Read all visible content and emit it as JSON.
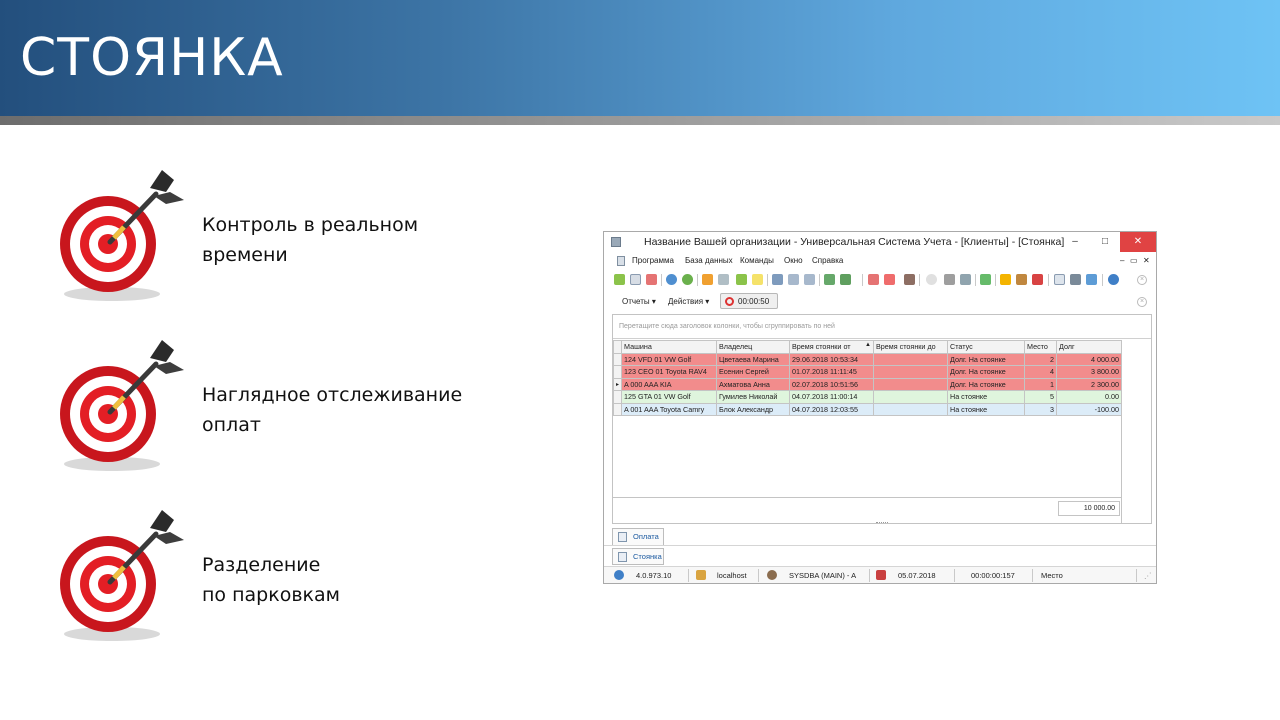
{
  "slide": {
    "title": "СТОЯНКА",
    "bullets": [
      {
        "line1": "Контроль в реальном",
        "line2": "времени"
      },
      {
        "line1": "Наглядное отслеживание",
        "line2": "оплат"
      },
      {
        "line1": "Разделение",
        "line2": "по парковкам"
      }
    ]
  },
  "app": {
    "window_title": "Название Вашей организации - Универсальная Система Учета - [Клиенты] - [Стоянка]",
    "window_buttons": {
      "minimize": "–",
      "maximize": "□",
      "close": "✕"
    },
    "menu": [
      "Программа",
      "База данных",
      "Команды",
      "Окно",
      "Справка"
    ],
    "mdi_buttons": [
      "–",
      "▭",
      "✕"
    ],
    "actions": {
      "reports": "Отчеты ▾",
      "operations": "Действия ▾",
      "timer": "00:00:50"
    },
    "group_hint": "Перетащите сюда заголовок колонки, чтобы сгруппировать по ней",
    "columns": [
      "Машина",
      "Владелец",
      "Время стоянки от",
      "Время стоянки до",
      "Статус",
      "Место",
      "Долг"
    ],
    "sort_indicator": "▲",
    "current_row_marker": "▸",
    "rows": [
      {
        "car": "124 VFD 01 VW Golf",
        "owner": "Цветаева Марина",
        "from": "29.06.2018 10:53:34",
        "to": "",
        "status": "Долг. На стоянке",
        "place": "2",
        "debt": "4 000.00",
        "color": "red",
        "marker": ""
      },
      {
        "car": "123 CEO 01 Toyota RAV4",
        "owner": "Есенин Сергей",
        "from": "01.07.2018 11:11:45",
        "to": "",
        "status": "Долг. На стоянке",
        "place": "4",
        "debt": "3 800.00",
        "color": "red",
        "marker": ""
      },
      {
        "car": "A 000 AAA KIA",
        "owner": "Ахматова Анна",
        "from": "02.07.2018 10:51:56",
        "to": "",
        "status": "Долг. На стоянке",
        "place": "1",
        "debt": "2 300.00",
        "color": "red",
        "marker": "▸"
      },
      {
        "car": "125 GTA 01 VW Golf",
        "owner": "Гумилев Николай",
        "from": "04.07.2018 11:00:14",
        "to": "",
        "status": "На стоянке",
        "place": "5",
        "debt": "0.00",
        "color": "green",
        "marker": ""
      },
      {
        "car": "A 001 AAA Toyota Camry",
        "owner": "Блок Александр",
        "from": "04.07.2018 12:03:55",
        "to": "",
        "status": "На стоянке",
        "place": "3",
        "debt": "-100.00",
        "color": "blue",
        "marker": ""
      }
    ],
    "total_debt": "10 000.00",
    "tabs": [
      "Оплата",
      "Стоянка"
    ],
    "status": {
      "version": "4.0.973.10",
      "server": "localhost",
      "user": "SYSDBA (MAIN) - A",
      "date": "05.07.2018",
      "elapsed": "00:00:00:157",
      "field": "Место"
    },
    "colors": {
      "debt_row": "#f28c8c",
      "paid_row": "#dff5dd",
      "credit_row": "#dcecf8",
      "close_button": "#e04343"
    }
  }
}
